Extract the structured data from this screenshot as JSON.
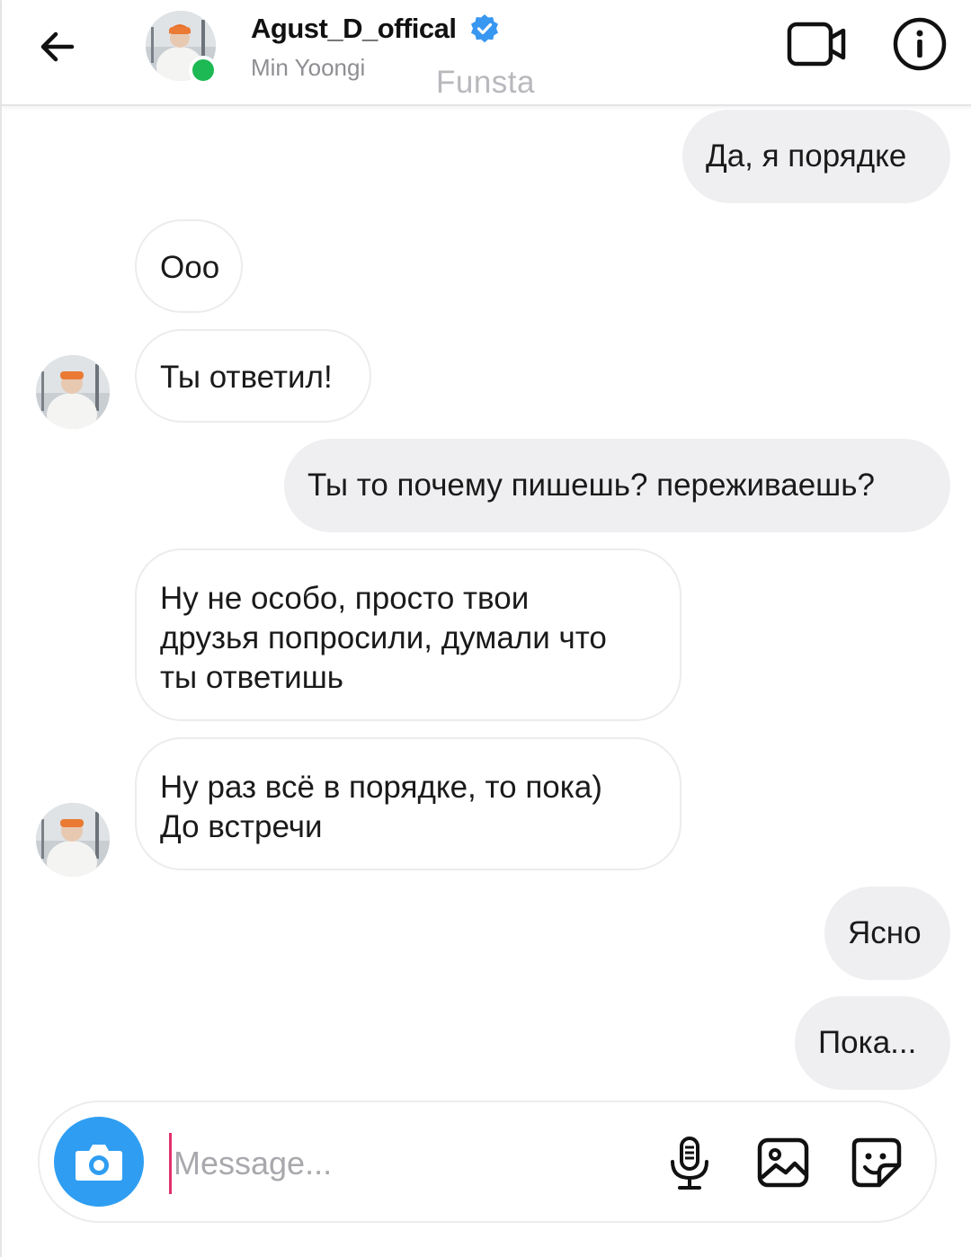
{
  "header": {
    "username": "Agust_D_offical",
    "full_name": "Min Yoongi",
    "account_label": "Funsta",
    "online_color": "#1db954",
    "verified_color": "#3897f0"
  },
  "messages": [
    {
      "direction": "outgoing",
      "text": "Да, я порядке"
    },
    {
      "direction": "incoming",
      "text": "Ooo"
    },
    {
      "direction": "incoming",
      "text": "Ты ответил!"
    },
    {
      "direction": "outgoing",
      "text": "Ты то почему пишешь? переживаешь?"
    },
    {
      "direction": "incoming",
      "lines": [
        "Ну не особо, просто твои",
        "друзья попросили, думали что",
        "ты ответишь"
      ]
    },
    {
      "direction": "incoming",
      "lines": [
        "Ну раз всё в порядке, то пока)",
        "До встречи"
      ]
    },
    {
      "direction": "outgoing",
      "text": "Ясно"
    },
    {
      "direction": "outgoing",
      "text": "Пока..."
    }
  ],
  "composer": {
    "placeholder": "Message...",
    "accent_color": "#2f9ef2"
  },
  "icons": {
    "back": "arrow-left-icon",
    "video": "video-camera-icon",
    "info": "info-icon",
    "camera": "camera-icon",
    "mic": "microphone-icon",
    "gallery": "image-icon",
    "sticker": "sticker-icon",
    "verified": "verified-badge-icon"
  }
}
